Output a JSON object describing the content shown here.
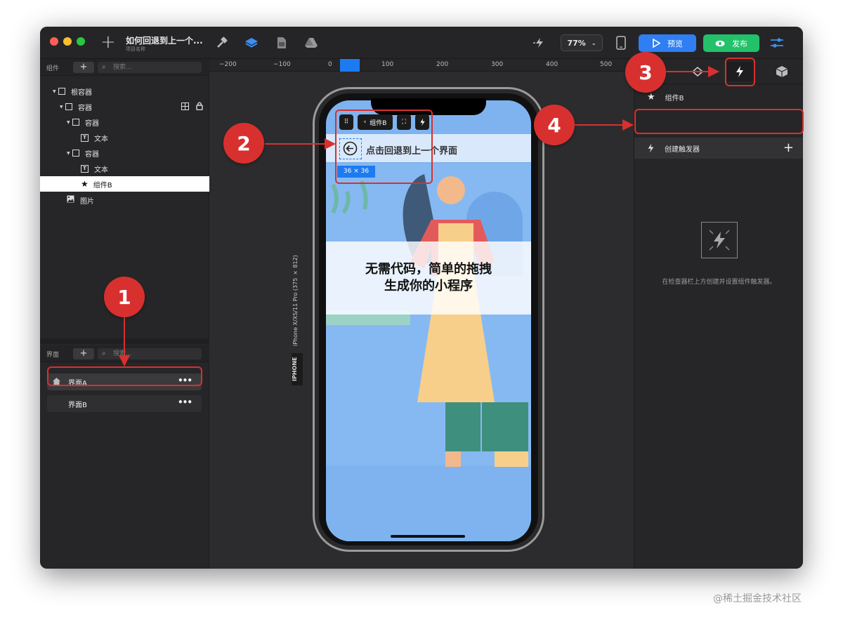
{
  "toolbar": {
    "project_title": "如何回退到上一个...",
    "project_subtitle": "项目名称",
    "zoom": "77%",
    "preview_label": "预览",
    "publish_label": "发布"
  },
  "components_panel": {
    "title": "组件",
    "search_placeholder": "搜索...",
    "tree": [
      {
        "label": "根容器"
      },
      {
        "label": "容器"
      },
      {
        "label": "容器"
      },
      {
        "label": "文本"
      },
      {
        "label": "容器"
      },
      {
        "label": "文本"
      },
      {
        "label": "组件B"
      },
      {
        "label": "图片"
      }
    ]
  },
  "pages_panel": {
    "title": "界面",
    "search_placeholder": "搜索...",
    "pages": [
      {
        "label": "界面A"
      },
      {
        "label": "界面B"
      }
    ],
    "more": "•••"
  },
  "ruler": {
    "ticks": [
      "−200",
      "−100",
      "0",
      "100",
      "200",
      "300",
      "400",
      "500"
    ]
  },
  "canvas": {
    "device_label": "iPhone X/XS/11 Pro (375  × 812)",
    "device_tag": "IPHONE",
    "mini_toolbar_label": "组件B",
    "navbar_text": "点击回退到上一个界面",
    "size_tag": "36 × 36",
    "banner_text": "无需代码，简单的拖拽\n生成你的小程序"
  },
  "inspector": {
    "component_name": "组件B",
    "create_trigger": "创建触发器",
    "empty_hint": "在检查器栏上方创建并设置组件触发器。"
  },
  "annotations": [
    "1",
    "2",
    "3",
    "4"
  ],
  "watermark": "@稀土掘金技术社区",
  "colors": {
    "accent_blue": "#2f7ef2",
    "publish_green": "#22c16a",
    "annotation_red": "#d8302f"
  }
}
